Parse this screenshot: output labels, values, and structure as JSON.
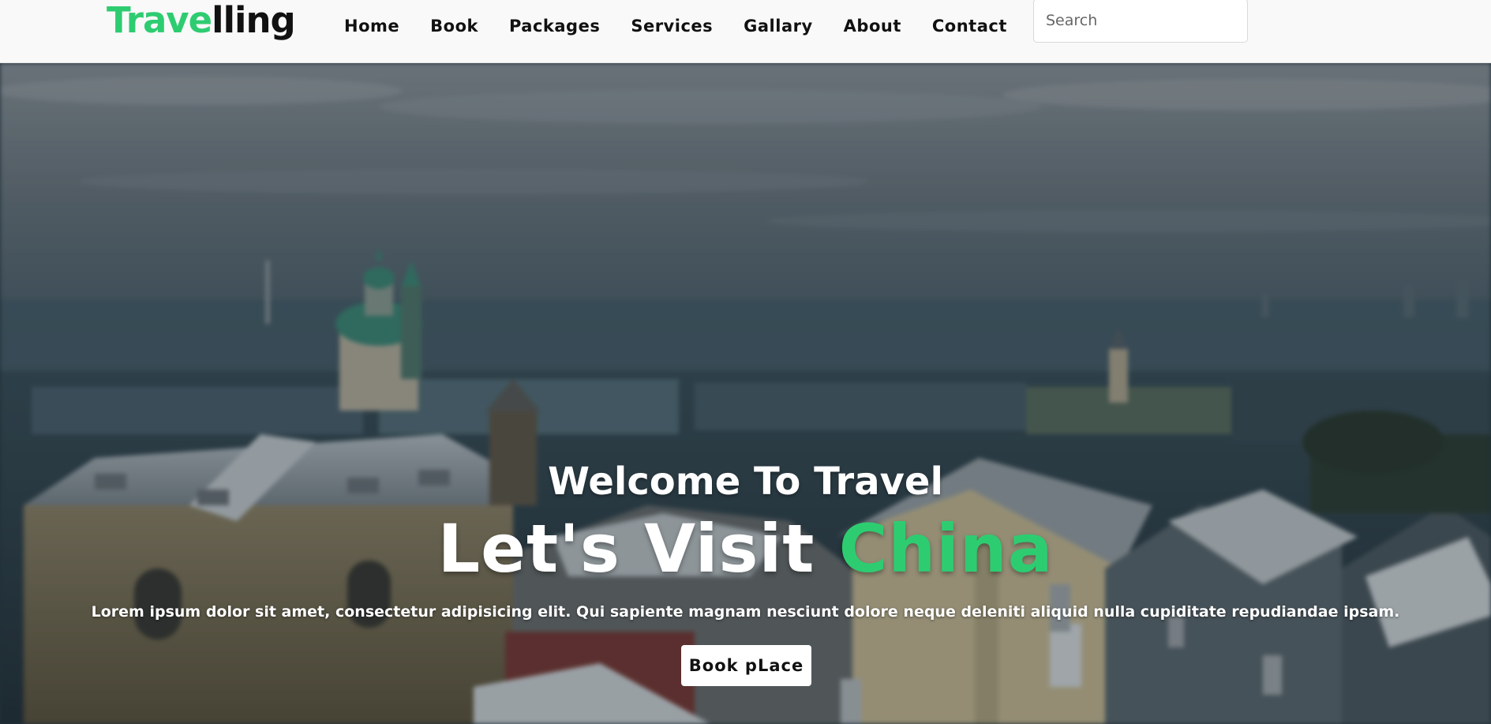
{
  "header": {
    "logo": {
      "part1": "Trave",
      "part2": "lling"
    },
    "nav": [
      {
        "label": "Home"
      },
      {
        "label": "Book"
      },
      {
        "label": "Packages"
      },
      {
        "label": "Services"
      },
      {
        "label": "Gallary"
      },
      {
        "label": "About"
      },
      {
        "label": "Contact"
      }
    ],
    "search": {
      "placeholder": "Search",
      "value": ""
    }
  },
  "hero": {
    "subtitle": "Welcome To Travel",
    "title_prefix": "Let's Visit ",
    "title_accent": "China",
    "description": "Lorem ipsum dolor sit amet, consectetur adipisicing elit. Qui sapiente magnam nesciunt dolore neque deleniti aliquid nulla cupiditate repudiandae ipsam.",
    "button_label": "Book pLace"
  },
  "colors": {
    "accent": "#2ecc71",
    "navbar_bg": "#f9f9f9",
    "text_dark": "#111111",
    "hero_text": "#ffffff"
  }
}
